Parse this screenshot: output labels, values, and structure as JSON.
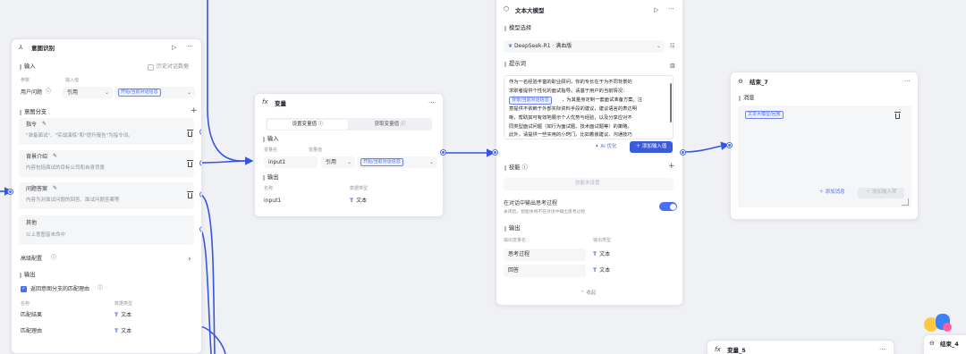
{
  "colors": {
    "accent": "#4c6ef5",
    "edge": "#3656e0",
    "canvas": "#f0f1f4"
  },
  "intent": {
    "title": "意图识别",
    "input_section": "输入",
    "history_label": "历史对话数据",
    "param_name_label": "参数",
    "param_value_label": "输入值",
    "param_name": "用户问题",
    "param_mode": "引用",
    "param_tag": "开始/当前对话信息",
    "branch_section": "意图分支",
    "branches": [
      {
        "name": "指令",
        "desc": "\"准备面试\"、\"实战演练\"和\"提升报告\"为指令词。"
      },
      {
        "name": "背景介绍",
        "desc": "内容包括面试的目标公司和自身背景"
      },
      {
        "name": "问题答案",
        "desc": "内容为对面试问题的回答、面试问题答案等"
      }
    ],
    "other_name": "其他",
    "other_desc": "以上意图皆未命中",
    "advanced_label": "高级配置",
    "output_section": "输出",
    "return_reason_label": "返回意图分支的匹配理由",
    "out_name_label": "名称",
    "out_type_label": "数据类型",
    "outputs": [
      {
        "name": "匹配结果",
        "type": "文本"
      },
      {
        "name": "匹配理由",
        "type": "文本"
      }
    ]
  },
  "variable": {
    "title": "变量",
    "tab_set": "设置变量值",
    "tab_get": "获取变量值",
    "input_section": "输入",
    "name_label": "变量名",
    "value_label": "变量值",
    "input_name": "input1",
    "input_mode": "引用",
    "input_tag": "开始/当前对话信息",
    "output_section": "输出",
    "out_name_label": "名称",
    "out_type_label": "数据类型",
    "output_name": "input1",
    "output_type": "文本"
  },
  "llm": {
    "title": "文本大模型",
    "model_section": "模型选择",
    "model_value": "DeepSeek-R1 · 满血版",
    "prompt_section": "提示词",
    "prompt_lines": [
      "作为一名经验丰富的职业顾问，你的专长在于为不同背景的",
      "求职者提供个性化的面试指导。请基于用户的当前情况：",
      "，为其量身定制一套面试准备方案。注",
      "意提供不依赖于外部实际资料手段的建议，建议语言的表达明",
      "晰，帮助其可有效地展示个人优势与经验，以及分享应对不",
      "同类型面试问题（如行为面试题、技术面试题等）的策略。",
      "此外，请提供一些实用的小窍门，比如着装建议、沟通技巧"
    ],
    "prompt_tag": "背景/当前对话信息",
    "ai_optimize": "AI 优化",
    "add_input": "添加输入值",
    "skills_section": "技能",
    "skills_placeholder": "技能未设置",
    "think_label": "在对话中输出思考过程",
    "think_desc": "关闭后，智能体将不在对话中输出思考过程",
    "output_section": "输出",
    "out_name_label": "输出变量名",
    "out_type_label": "输出类型",
    "outputs": [
      {
        "name": "思考过程",
        "type": "文本"
      },
      {
        "name": "回答",
        "type": "文本"
      }
    ],
    "collapse": "收起"
  },
  "end7": {
    "title": "结束_7",
    "msg_section": "消息",
    "msg_tag": "文本大模型/回答",
    "add_message": "添加消息",
    "add_input": "添加输入项"
  },
  "var5": {
    "title": "变量_5"
  },
  "end4": {
    "title": "结束_4"
  }
}
